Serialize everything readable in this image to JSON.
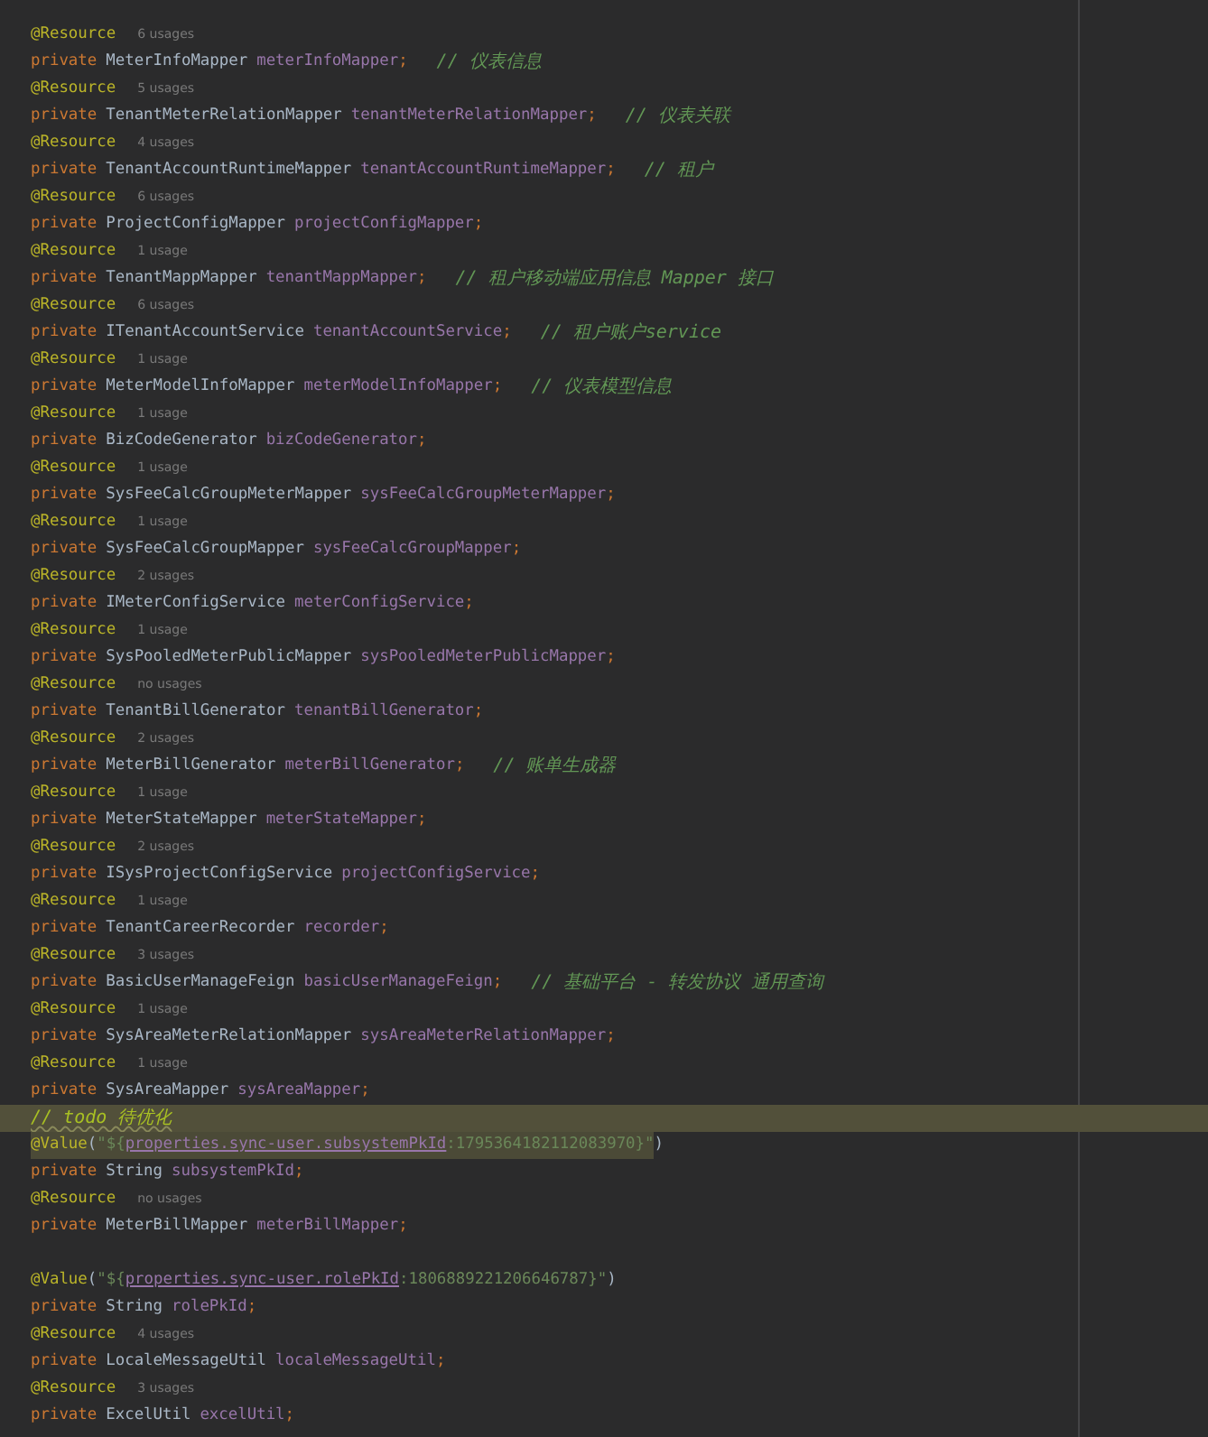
{
  "editor": {
    "lines": [
      {
        "kind": "annotation",
        "text": "@Resource",
        "hint": "6 usages"
      },
      {
        "kind": "field",
        "modifier": "private",
        "type": "MeterInfoMapper",
        "name": "meterInfoMapper",
        "end": ";",
        "comment": "// 仪表信息"
      },
      {
        "kind": "annotation",
        "text": "@Resource",
        "hint": "5 usages"
      },
      {
        "kind": "field",
        "modifier": "private",
        "type": "TenantMeterRelationMapper",
        "name": "tenantMeterRelationMapper",
        "end": ";",
        "comment": "// 仪表关联"
      },
      {
        "kind": "annotation",
        "text": "@Resource",
        "hint": "4 usages"
      },
      {
        "kind": "field",
        "modifier": "private",
        "type": "TenantAccountRuntimeMapper",
        "name": "tenantAccountRuntimeMapper",
        "end": ";",
        "comment": "// 租户"
      },
      {
        "kind": "annotation",
        "text": "@Resource",
        "hint": "6 usages"
      },
      {
        "kind": "field",
        "modifier": "private",
        "type": "ProjectConfigMapper",
        "name": "projectConfigMapper",
        "end": ";"
      },
      {
        "kind": "annotation",
        "text": "@Resource",
        "hint": "1 usage"
      },
      {
        "kind": "field",
        "modifier": "private",
        "type": "TenantMappMapper",
        "name": "tenantMappMapper",
        "end": ";",
        "comment": "// 租户移动端应用信息 Mapper 接口"
      },
      {
        "kind": "annotation",
        "text": "@Resource",
        "hint": "6 usages"
      },
      {
        "kind": "field",
        "modifier": "private",
        "type": "ITenantAccountService",
        "name": "tenantAccountService",
        "end": ";",
        "comment": "// 租户账户service"
      },
      {
        "kind": "annotation",
        "text": "@Resource",
        "hint": "1 usage"
      },
      {
        "kind": "field",
        "modifier": "private",
        "type": "MeterModelInfoMapper",
        "name": "meterModelInfoMapper",
        "end": ";",
        "comment": "// 仪表模型信息"
      },
      {
        "kind": "annotation",
        "text": "@Resource",
        "hint": "1 usage"
      },
      {
        "kind": "field",
        "modifier": "private",
        "type": "BizCodeGenerator",
        "name": "bizCodeGenerator",
        "end": ";"
      },
      {
        "kind": "annotation",
        "text": "@Resource",
        "hint": "1 usage"
      },
      {
        "kind": "field",
        "modifier": "private",
        "type": "SysFeeCalcGroupMeterMapper",
        "name": "sysFeeCalcGroupMeterMapper",
        "end": ";"
      },
      {
        "kind": "annotation",
        "text": "@Resource",
        "hint": "1 usage"
      },
      {
        "kind": "field",
        "modifier": "private",
        "type": "SysFeeCalcGroupMapper",
        "name": "sysFeeCalcGroupMapper",
        "end": ";"
      },
      {
        "kind": "annotation",
        "text": "@Resource",
        "hint": "2 usages"
      },
      {
        "kind": "field",
        "modifier": "private",
        "type": "IMeterConfigService",
        "name": "meterConfigService",
        "end": ";"
      },
      {
        "kind": "annotation",
        "text": "@Resource",
        "hint": "1 usage"
      },
      {
        "kind": "field",
        "modifier": "private",
        "type": "SysPooledMeterPublicMapper",
        "name": "sysPooledMeterPublicMapper",
        "end": ";"
      },
      {
        "kind": "annotation",
        "text": "@Resource",
        "hint": "no usages"
      },
      {
        "kind": "field",
        "modifier": "private",
        "type": "TenantBillGenerator",
        "name": "tenantBillGenerator",
        "end": ";"
      },
      {
        "kind": "annotation",
        "text": "@Resource",
        "hint": "2 usages"
      },
      {
        "kind": "field",
        "modifier": "private",
        "type": "MeterBillGenerator",
        "name": "meterBillGenerator",
        "end": ";",
        "comment": "// 账单生成器"
      },
      {
        "kind": "annotation",
        "text": "@Resource",
        "hint": "1 usage"
      },
      {
        "kind": "field",
        "modifier": "private",
        "type": "MeterStateMapper",
        "name": "meterStateMapper",
        "end": ";"
      },
      {
        "kind": "annotation",
        "text": "@Resource",
        "hint": "2 usages"
      },
      {
        "kind": "field",
        "modifier": "private",
        "type": "ISysProjectConfigService",
        "name": "projectConfigService",
        "end": ";"
      },
      {
        "kind": "annotation",
        "text": "@Resource",
        "hint": "1 usage"
      },
      {
        "kind": "field",
        "modifier": "private",
        "type": "TenantCareerRecorder",
        "name": "recorder",
        "end": ";"
      },
      {
        "kind": "annotation",
        "text": "@Resource",
        "hint": "3 usages"
      },
      {
        "kind": "field",
        "modifier": "private",
        "type": "BasicUserManageFeign",
        "name": "basicUserManageFeign",
        "end": ";",
        "comment": "// 基础平台 - 转发协议 通用查询"
      },
      {
        "kind": "annotation",
        "text": "@Resource",
        "hint": "1 usage"
      },
      {
        "kind": "field",
        "modifier": "private",
        "type": "SysAreaMeterRelationMapper",
        "name": "sysAreaMeterRelationMapper",
        "end": ";"
      },
      {
        "kind": "annotation",
        "text": "@Resource",
        "hint": "1 usage"
      },
      {
        "kind": "field",
        "modifier": "private",
        "type": "SysAreaMapper",
        "name": "sysAreaMapper",
        "end": ";"
      },
      {
        "kind": "comment",
        "text": "// todo 待优化",
        "caret_line": true
      },
      {
        "kind": "value",
        "annotation": "@Value",
        "open": "(",
        "string_start": "\"${",
        "key": "properties.sync-user.subsystemPkId",
        "string_end": ":1795364182112083970}\"",
        "close": ")",
        "selected": true
      },
      {
        "kind": "field",
        "modifier": "private",
        "type": "String",
        "name": "subsystemPkId",
        "end": ";"
      },
      {
        "kind": "annotation",
        "text": "@Resource",
        "hint": "no usages"
      },
      {
        "kind": "field",
        "modifier": "private",
        "type": "MeterBillMapper",
        "name": "meterBillMapper",
        "end": ";"
      },
      {
        "kind": "blank"
      },
      {
        "kind": "value",
        "annotation": "@Value",
        "open": "(",
        "string_start": "\"${",
        "key": "properties.sync-user.rolePkId",
        "string_end": ":1806889221206646787}\"",
        "close": ")",
        "selected": false
      },
      {
        "kind": "field",
        "modifier": "private",
        "type": "String",
        "name": "rolePkId",
        "end": ";"
      },
      {
        "kind": "annotation",
        "text": "@Resource",
        "hint": "4 usages"
      },
      {
        "kind": "field",
        "modifier": "private",
        "type": "LocaleMessageUtil",
        "name": "localeMessageUtil",
        "end": ";"
      },
      {
        "kind": "annotation",
        "text": "@Resource",
        "hint": "3 usages"
      },
      {
        "kind": "field",
        "modifier": "private",
        "type": "ExcelUtil",
        "name": "excelUtil",
        "end": ";"
      }
    ]
  }
}
